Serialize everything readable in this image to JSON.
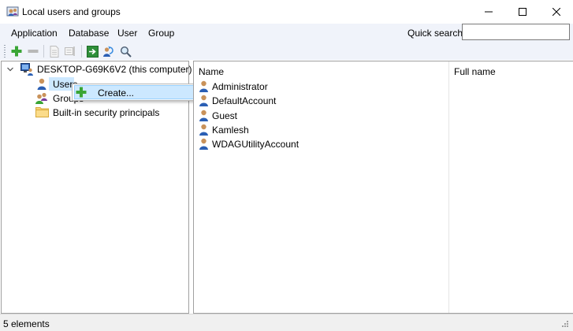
{
  "window": {
    "title": "Local users and groups",
    "icon": "users-app-icon",
    "controls": [
      "minimize-icon",
      "maximize-icon",
      "close-icon"
    ]
  },
  "menubar": {
    "items": [
      "Application",
      "Database",
      "User",
      "Group"
    ]
  },
  "quick_search": {
    "label": "Quick search:",
    "value": ""
  },
  "toolbar": {
    "buttons": [
      "add-icon",
      "remove-icon",
      "properties-icon",
      "rename-icon",
      "export-icon",
      "refresh-icon",
      "search-icon"
    ]
  },
  "tree": {
    "root": "DESKTOP-G69K6V2 (this computer)",
    "children": [
      "Users",
      "Groups",
      "Built-in security principals"
    ],
    "selected": "Users"
  },
  "context_menu": {
    "items": [
      {
        "label": "Create...",
        "icon": "add-icon"
      }
    ]
  },
  "list": {
    "columns": [
      "Name",
      "Full name"
    ],
    "rows": [
      {
        "name": "Administrator",
        "full_name": ""
      },
      {
        "name": "DefaultAccount",
        "full_name": ""
      },
      {
        "name": "Guest",
        "full_name": ""
      },
      {
        "name": "Kamlesh",
        "full_name": ""
      },
      {
        "name": "WDAGUtilityAccount",
        "full_name": ""
      }
    ]
  },
  "statusbar": {
    "text": "5 elements"
  },
  "colors": {
    "menubar_bg": "#f0f3fa",
    "selection": "#cce8ff",
    "add_green": "#3aa535",
    "user_blue": "#2b5fb4"
  }
}
